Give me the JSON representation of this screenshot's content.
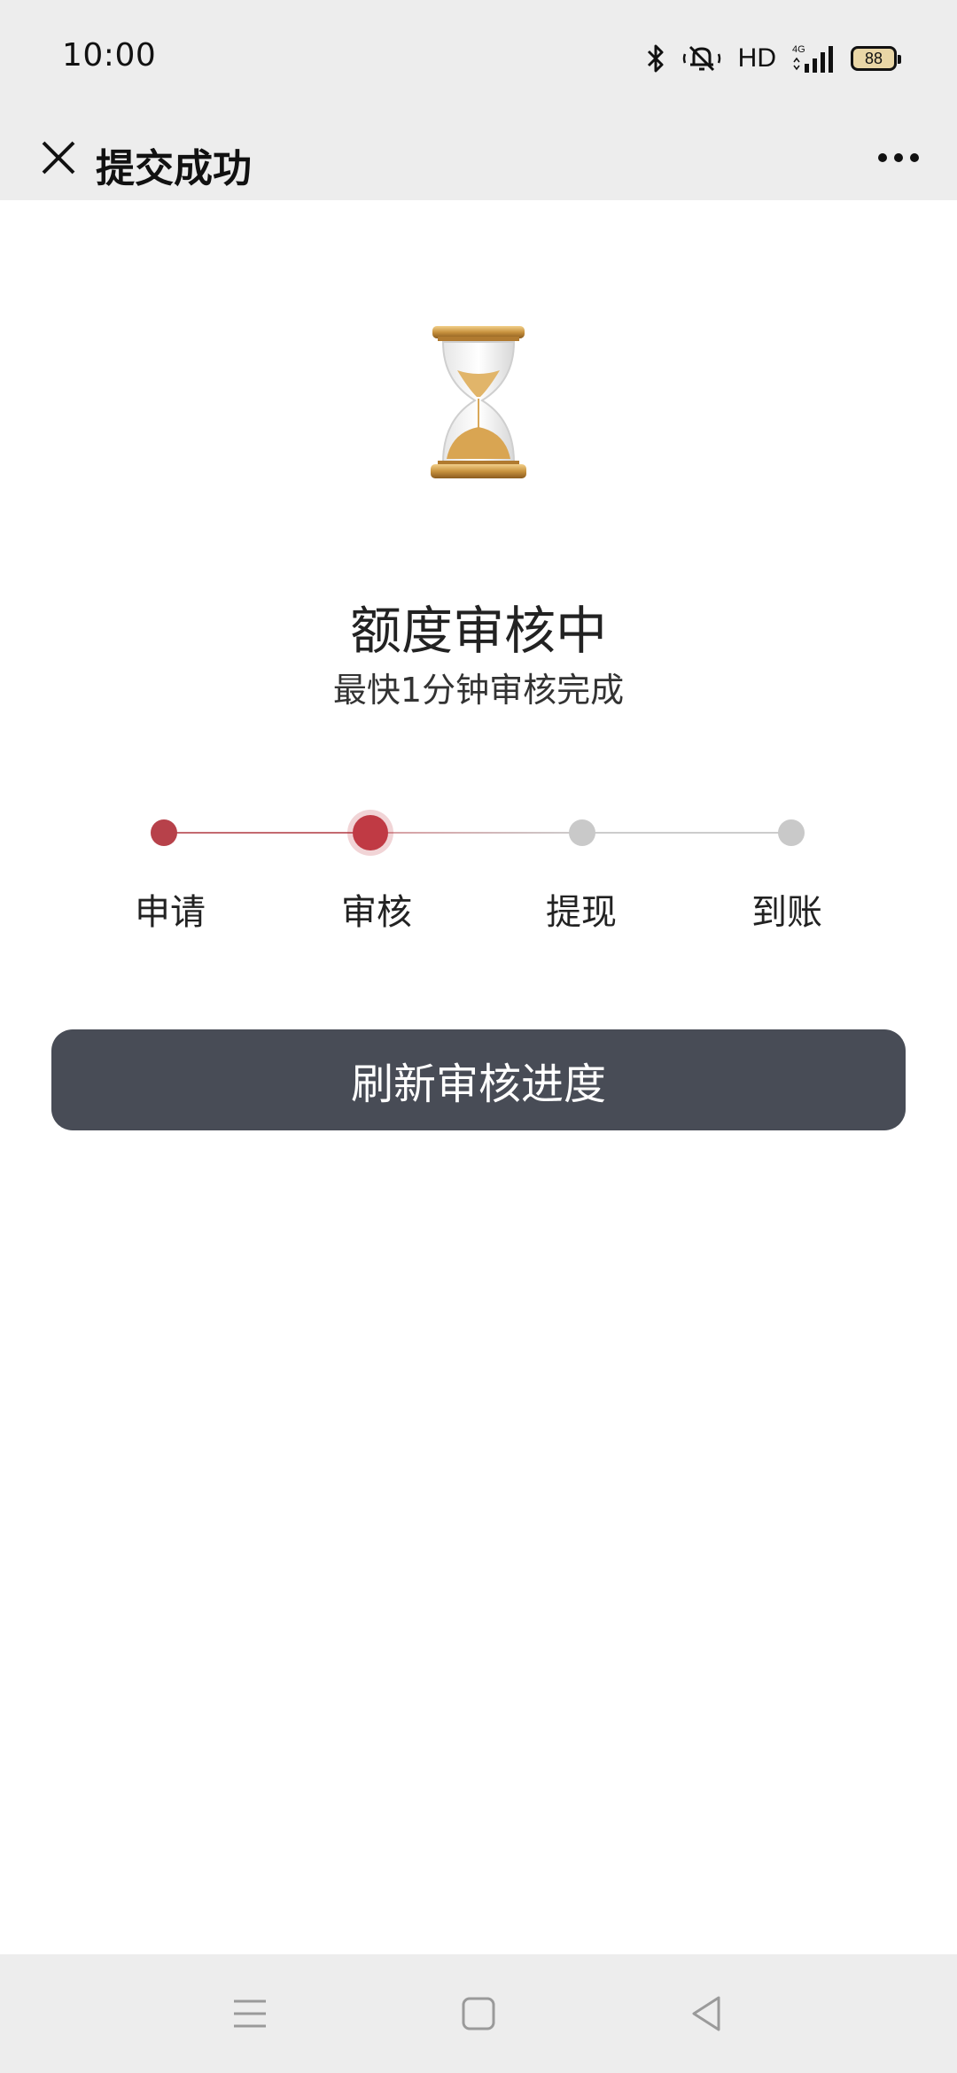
{
  "status_bar": {
    "time": "10:00",
    "network_label": "HD",
    "network_type": "4G",
    "battery_level": "88",
    "icons": [
      "bluetooth-icon",
      "mute-icon",
      "signal-icon",
      "battery-icon"
    ]
  },
  "title_bar": {
    "title": "提交成功",
    "close_icon": "close-icon",
    "more_icon": "more-icon"
  },
  "content": {
    "hourglass_icon": "hourglass-icon",
    "heading": "额度审核中",
    "subtext": "最快1分钟审核完成"
  },
  "progress": {
    "steps": [
      {
        "label": "申请",
        "state": "done"
      },
      {
        "label": "审核",
        "state": "current"
      },
      {
        "label": "提现",
        "state": "pending"
      },
      {
        "label": "到账",
        "state": "pending"
      }
    ],
    "colors": {
      "active": "#c03a44",
      "inactive": "#c9c9c9"
    }
  },
  "actions": {
    "refresh_label": "刷新审核进度"
  },
  "nav_bar": {
    "items": [
      "menu-icon",
      "home-icon",
      "back-icon"
    ]
  },
  "colors": {
    "bar_background": "#ededed",
    "button_background": "#484c56"
  }
}
